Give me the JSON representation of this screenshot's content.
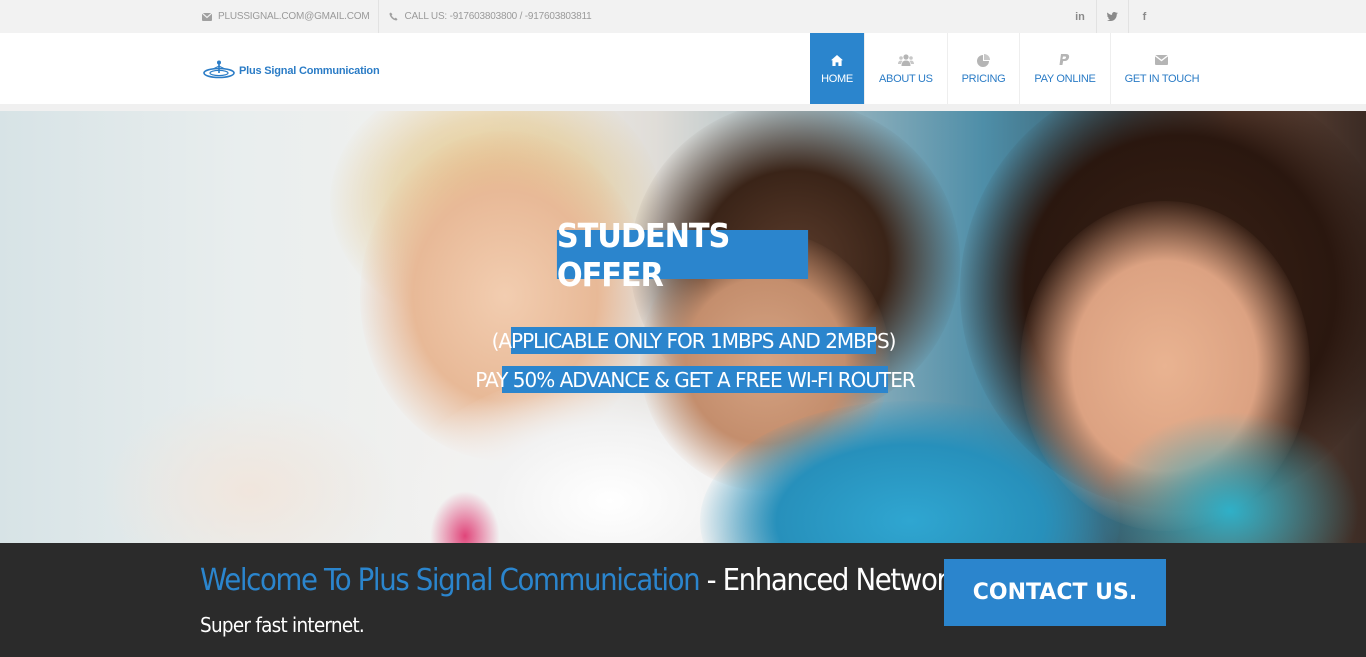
{
  "topbar": {
    "email": "PLUSSIGNAL.COM@GMAIL.COM",
    "phone": "CALL US: -917603803800 / -917603803811",
    "email_icon": "envelope-icon",
    "phone_icon": "phone-icon",
    "social": [
      {
        "name": "linkedin-icon",
        "glyph": "in"
      },
      {
        "name": "twitter-icon",
        "glyph": "🐦"
      },
      {
        "name": "facebook-icon",
        "glyph": "f"
      }
    ]
  },
  "header": {
    "logo_text": "Plus Signal Communication",
    "nav": [
      {
        "label": "HOME",
        "icon": "home-icon",
        "active": true
      },
      {
        "label": "ABOUT US",
        "icon": "users-icon",
        "active": false
      },
      {
        "label": "PRICING",
        "icon": "pie-chart-icon",
        "active": false
      },
      {
        "label": "PAY ONLINE",
        "icon": "paypal-icon",
        "active": false
      },
      {
        "label": "GET IN TOUCH",
        "icon": "envelope-icon",
        "active": false
      }
    ]
  },
  "hero": {
    "title": "STUDENTS OFFER",
    "line1": "(APPLICABLE ONLY FOR 1MBPS AND 2MBPS)",
    "line2": "PAY 50% ADVANCE & GET A FREE WI-FI ROUTER"
  },
  "bottom": {
    "welcome_blue": "Welcome To Plus Signal Communication",
    "welcome_white": " - Enhanced Network.",
    "subline": "Super fast internet.",
    "contact_button": "CONTACT US."
  },
  "colors": {
    "accent": "#2b85cd",
    "dark_bar": "#2b2b2b",
    "topbar": "#f2f2f2"
  }
}
